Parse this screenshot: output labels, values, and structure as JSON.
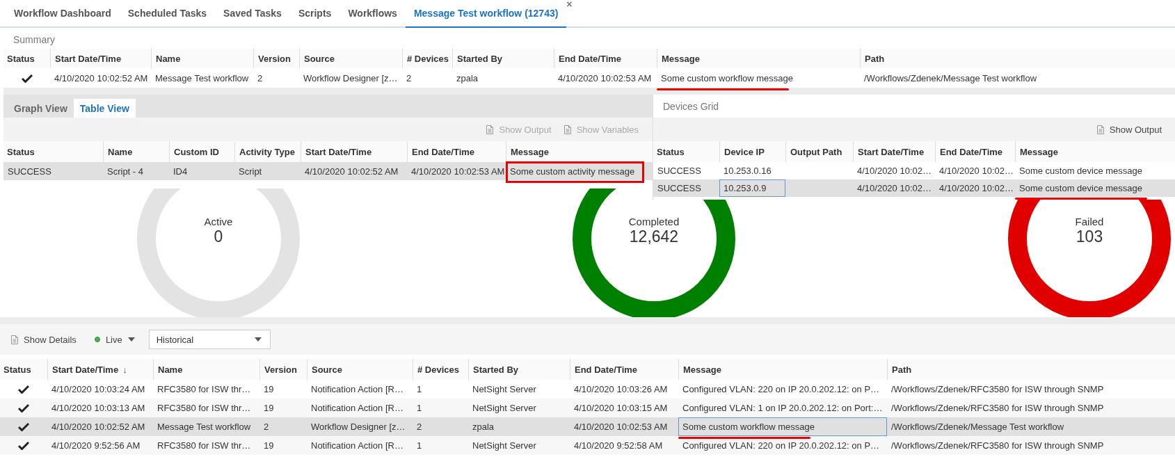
{
  "tabs": [
    {
      "label": "Workflow Dashboard",
      "selected": false
    },
    {
      "label": "Scheduled Tasks",
      "selected": false
    },
    {
      "label": "Saved Tasks",
      "selected": false
    },
    {
      "label": "Scripts",
      "selected": false
    },
    {
      "label": "Workflows",
      "selected": false
    },
    {
      "label": "Message Test workflow (12743)",
      "selected": true,
      "close": "×"
    }
  ],
  "summary": {
    "title": "Summary",
    "columns": [
      {
        "label": "Status"
      },
      {
        "label": "Start Date/Time"
      },
      {
        "label": "Name"
      },
      {
        "label": "Version"
      },
      {
        "label": "Source"
      },
      {
        "label": "# Devices"
      },
      {
        "label": "Started By"
      },
      {
        "label": "End Date/Time"
      },
      {
        "label": "Message"
      },
      {
        "label": "Path"
      }
    ],
    "rows": [
      {
        "selected": false,
        "cells": [
          {
            "checked": true
          },
          "4/10/2020 10:02:52 AM",
          "Message Test workflow",
          "2",
          "Workflow Designer [z…",
          "2",
          "zpala",
          "4/10/2020 10:02:53 AM",
          {
            "text": "Some custom workflow message",
            "underlined": true
          },
          "/Workflows/Zdenek/Message Test workflow"
        ]
      }
    ]
  },
  "activities": {
    "tabs": [
      {
        "label": "Graph View",
        "selected": false
      },
      {
        "label": "Table View",
        "selected": true
      }
    ],
    "toolbar": [
      {
        "label": "Show Output",
        "disabled": true
      },
      {
        "label": "Show Variables",
        "disabled": true
      }
    ],
    "columns": [
      {
        "label": "Status"
      },
      {
        "label": "Name"
      },
      {
        "label": "Custom ID"
      },
      {
        "label": "Activity Type"
      },
      {
        "label": "Start Date/Time"
      },
      {
        "label": "End Date/Time"
      },
      {
        "label": "Message"
      }
    ],
    "rows": [
      {
        "selected": true,
        "cells": [
          "SUCCESS",
          "Script - 4",
          "ID4",
          "Script",
          "4/10/2020 10:02:52 AM",
          "4/10/2020 10:02:53 AM",
          {
            "text": "Some custom activity message",
            "boxed": true
          }
        ]
      }
    ]
  },
  "devices": {
    "title": "Devices Grid",
    "toolbar": [
      {
        "label": "Show Output",
        "disabled": false
      }
    ],
    "columns": [
      {
        "label": "Status"
      },
      {
        "label": "Device IP"
      },
      {
        "label": "Output Path"
      },
      {
        "label": "Start Date/Time"
      },
      {
        "label": "End Date/Time"
      },
      {
        "label": "Message"
      }
    ],
    "rows": [
      {
        "selected": false,
        "cells": [
          "SUCCESS",
          "10.253.0.16",
          "",
          "4/10/2020 10:02…",
          "4/10/2020 10:02…",
          "Some custom device message"
        ]
      },
      {
        "selected": true,
        "cells": [
          "SUCCESS",
          {
            "text": "10.253.0.9",
            "focused": true
          },
          "",
          "4/10/2020 10:02…",
          "4/10/2020 10:02…",
          {
            "text": "Some custom device message",
            "underlined": true
          }
        ]
      }
    ]
  },
  "stats": [
    {
      "label": "Active",
      "value": "0",
      "color": "#e3e3e3"
    },
    {
      "label": "Completed",
      "value": "12,642",
      "color": "#008000"
    },
    {
      "label": "Failed",
      "value": "103",
      "color": "#e00000"
    }
  ],
  "history": {
    "toolbar": {
      "details": "Show Details",
      "live": {
        "label": "Live",
        "on": true
      },
      "filter": {
        "value": "Historical"
      }
    },
    "columns": [
      {
        "label": "Status"
      },
      {
        "label": "Start Date/Time",
        "sort": "↓"
      },
      {
        "label": "Name"
      },
      {
        "label": "Version"
      },
      {
        "label": "Source"
      },
      {
        "label": "# Devices"
      },
      {
        "label": "Started By"
      },
      {
        "label": "End Date/Time"
      },
      {
        "label": "Message"
      },
      {
        "label": "Path"
      }
    ],
    "rows": [
      {
        "selected": false,
        "cells": [
          {
            "checked": true
          },
          "4/10/2020 10:03:24 AM",
          "RFC3580 for ISW thr…",
          "19",
          "Notification Action [R…",
          "1",
          "NetSight Server",
          "4/10/2020 10:03:26 AM",
          "Configured VLAN: 220 on IP 20.0.202.12: on P…",
          "/Workflows/Zdenek/RFC3580 for ISW through SNMP"
        ]
      },
      {
        "selected": false,
        "cells": [
          {
            "checked": true
          },
          "4/10/2020 10:03:13 AM",
          "RFC3580 for ISW thr…",
          "19",
          "Notification Action [R…",
          "1",
          "NetSight Server",
          "4/10/2020 10:03:15 AM",
          "Configured VLAN: 1 on IP 20.0.202.12: on Port:…",
          "/Workflows/Zdenek/RFC3580 for ISW through SNMP"
        ]
      },
      {
        "selected": true,
        "cells": [
          {
            "checked": true
          },
          "4/10/2020 10:02:52 AM",
          "Message Test workflow",
          "2",
          "Workflow Designer [z…",
          "2",
          "zpala",
          "4/10/2020 10:02:53 AM",
          {
            "text": "Some custom workflow message",
            "focused": true,
            "underlined": true
          },
          "/Workflows/Zdenek/Message Test workflow"
        ]
      },
      {
        "selected": false,
        "cells": [
          {
            "checked": true
          },
          "4/10/2020 9:52:56 AM",
          "RFC3580 for ISW thr…",
          "19",
          "Notification Action [R…",
          "1",
          "NetSight Server",
          "4/10/2020 9:52:58 AM",
          "Configured VLAN: 220 on IP 20.0.202.12: on P…",
          "/Workflows/Zdenek/RFC3580 for ISW through SNMP"
        ]
      }
    ]
  }
}
